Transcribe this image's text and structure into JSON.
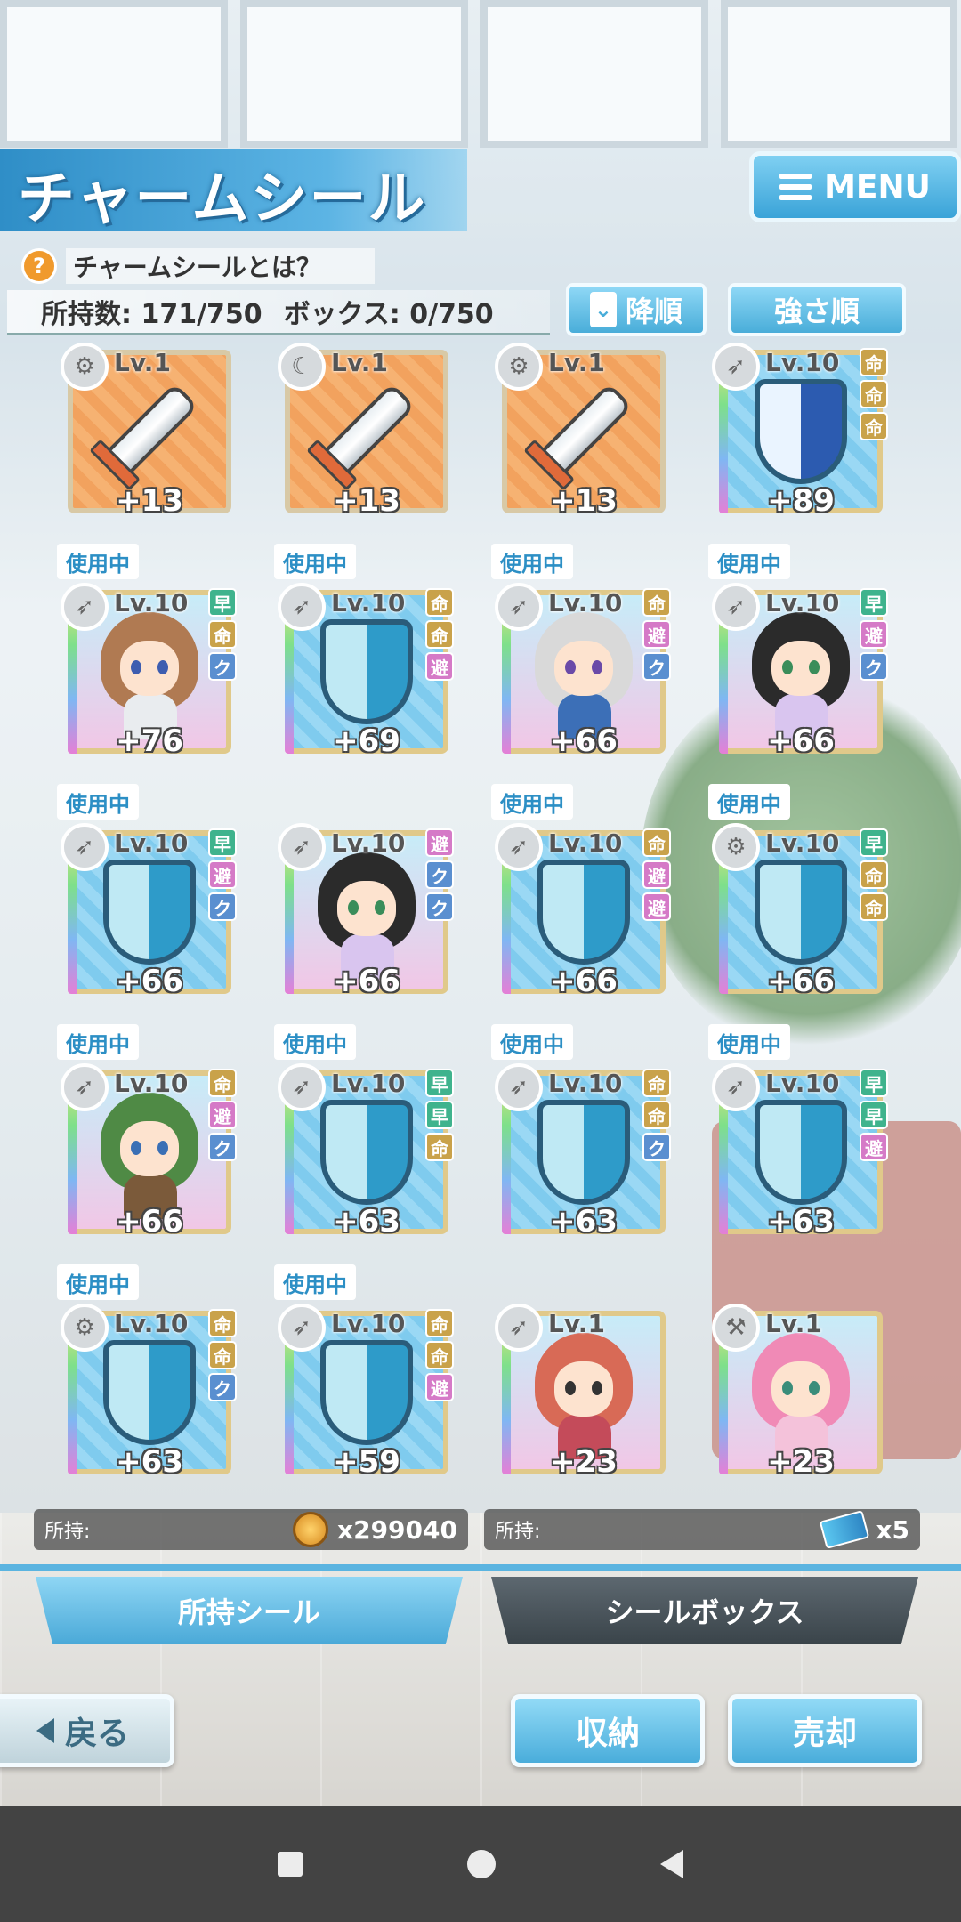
{
  "header": {
    "title": "チャームシール",
    "menu_label": "MENU",
    "help_text": "チャームシールとは？",
    "count_held": "所持数: 171/750",
    "count_box": "ボックス: 0/750",
    "sort_order_label": "降順",
    "sort_key_label": "強さ順"
  },
  "stickers": [
    {
      "type_icon": "gear-icon",
      "level": "Lv.1",
      "bonus": "+13",
      "art": "sword",
      "in_use": false,
      "badges": []
    },
    {
      "type_icon": "crescent-icon",
      "level": "Lv.1",
      "bonus": "+13",
      "art": "sword",
      "in_use": false,
      "badges": []
    },
    {
      "type_icon": "gear-icon",
      "level": "Lv.1",
      "bonus": "+13",
      "art": "sword",
      "in_use": false,
      "badges": []
    },
    {
      "type_icon": "feather-icon",
      "level": "Lv.10",
      "bonus": "+89",
      "art": "shield-navy",
      "in_use": false,
      "badges": [
        "命",
        "命",
        "命"
      ]
    },
    {
      "type_icon": "feather-icon",
      "level": "Lv.10",
      "bonus": "+76",
      "art": "chibi-brown",
      "in_use": true,
      "badges": [
        "早",
        "命",
        "ク"
      ]
    },
    {
      "type_icon": "feather-icon",
      "level": "Lv.10",
      "bonus": "+69",
      "art": "shield",
      "in_use": true,
      "badges": [
        "命",
        "命",
        "避"
      ]
    },
    {
      "type_icon": "feather-icon",
      "level": "Lv.10",
      "bonus": "+66",
      "art": "chibi-duo",
      "in_use": true,
      "badges": [
        "命",
        "避",
        "ク"
      ]
    },
    {
      "type_icon": "feather-icon",
      "level": "Lv.10",
      "bonus": "+66",
      "art": "chibi-black",
      "in_use": true,
      "badges": [
        "早",
        "避",
        "ク"
      ]
    },
    {
      "type_icon": "feather-icon",
      "level": "Lv.10",
      "bonus": "+66",
      "art": "shield",
      "in_use": true,
      "badges": [
        "早",
        "避",
        "ク"
      ]
    },
    {
      "type_icon": "feather-icon",
      "level": "Lv.10",
      "bonus": "+66",
      "art": "chibi-black",
      "in_use": false,
      "badges": [
        "避",
        "ク",
        "ク"
      ]
    },
    {
      "type_icon": "feather-icon",
      "level": "Lv.10",
      "bonus": "+66",
      "art": "shield",
      "in_use": true,
      "badges": [
        "命",
        "避",
        "避"
      ]
    },
    {
      "type_icon": "gear-icon",
      "level": "Lv.10",
      "bonus": "+66",
      "art": "shield",
      "in_use": true,
      "badges": [
        "早",
        "命",
        "命"
      ]
    },
    {
      "type_icon": "feather-icon",
      "level": "Lv.10",
      "bonus": "+66",
      "art": "chibi-green",
      "in_use": true,
      "badges": [
        "命",
        "避",
        "ク"
      ]
    },
    {
      "type_icon": "feather-icon",
      "level": "Lv.10",
      "bonus": "+63",
      "art": "shield",
      "in_use": true,
      "badges": [
        "早",
        "早",
        "命"
      ]
    },
    {
      "type_icon": "feather-icon",
      "level": "Lv.10",
      "bonus": "+63",
      "art": "shield",
      "in_use": true,
      "badges": [
        "命",
        "命",
        "ク"
      ]
    },
    {
      "type_icon": "feather-icon",
      "level": "Lv.10",
      "bonus": "+63",
      "art": "shield",
      "in_use": true,
      "badges": [
        "早",
        "早",
        "避"
      ]
    },
    {
      "type_icon": "gear-icon",
      "level": "Lv.10",
      "bonus": "+63",
      "art": "shield",
      "in_use": true,
      "badges": [
        "命",
        "命",
        "ク"
      ]
    },
    {
      "type_icon": "feather-icon",
      "level": "Lv.10",
      "bonus": "+59",
      "art": "shield",
      "in_use": true,
      "badges": [
        "命",
        "命",
        "避"
      ]
    },
    {
      "type_icon": "feather-icon",
      "level": "Lv.1",
      "bonus": "+23",
      "art": "chibi-red",
      "in_use": false,
      "badges": []
    },
    {
      "type_icon": "hammer-icon",
      "level": "Lv.1",
      "bonus": "+23",
      "art": "chibi-pink",
      "in_use": false,
      "badges": []
    }
  ],
  "in_use_label": "使用中",
  "holdings": {
    "coin_label": "所持:",
    "coin_value": "x299040",
    "ticket_label": "所持:",
    "ticket_value": "x5"
  },
  "tabs": {
    "owned": "所持シール",
    "box": "シールボックス"
  },
  "buttons": {
    "back": "戻る",
    "store": "収納",
    "sell": "売却"
  }
}
